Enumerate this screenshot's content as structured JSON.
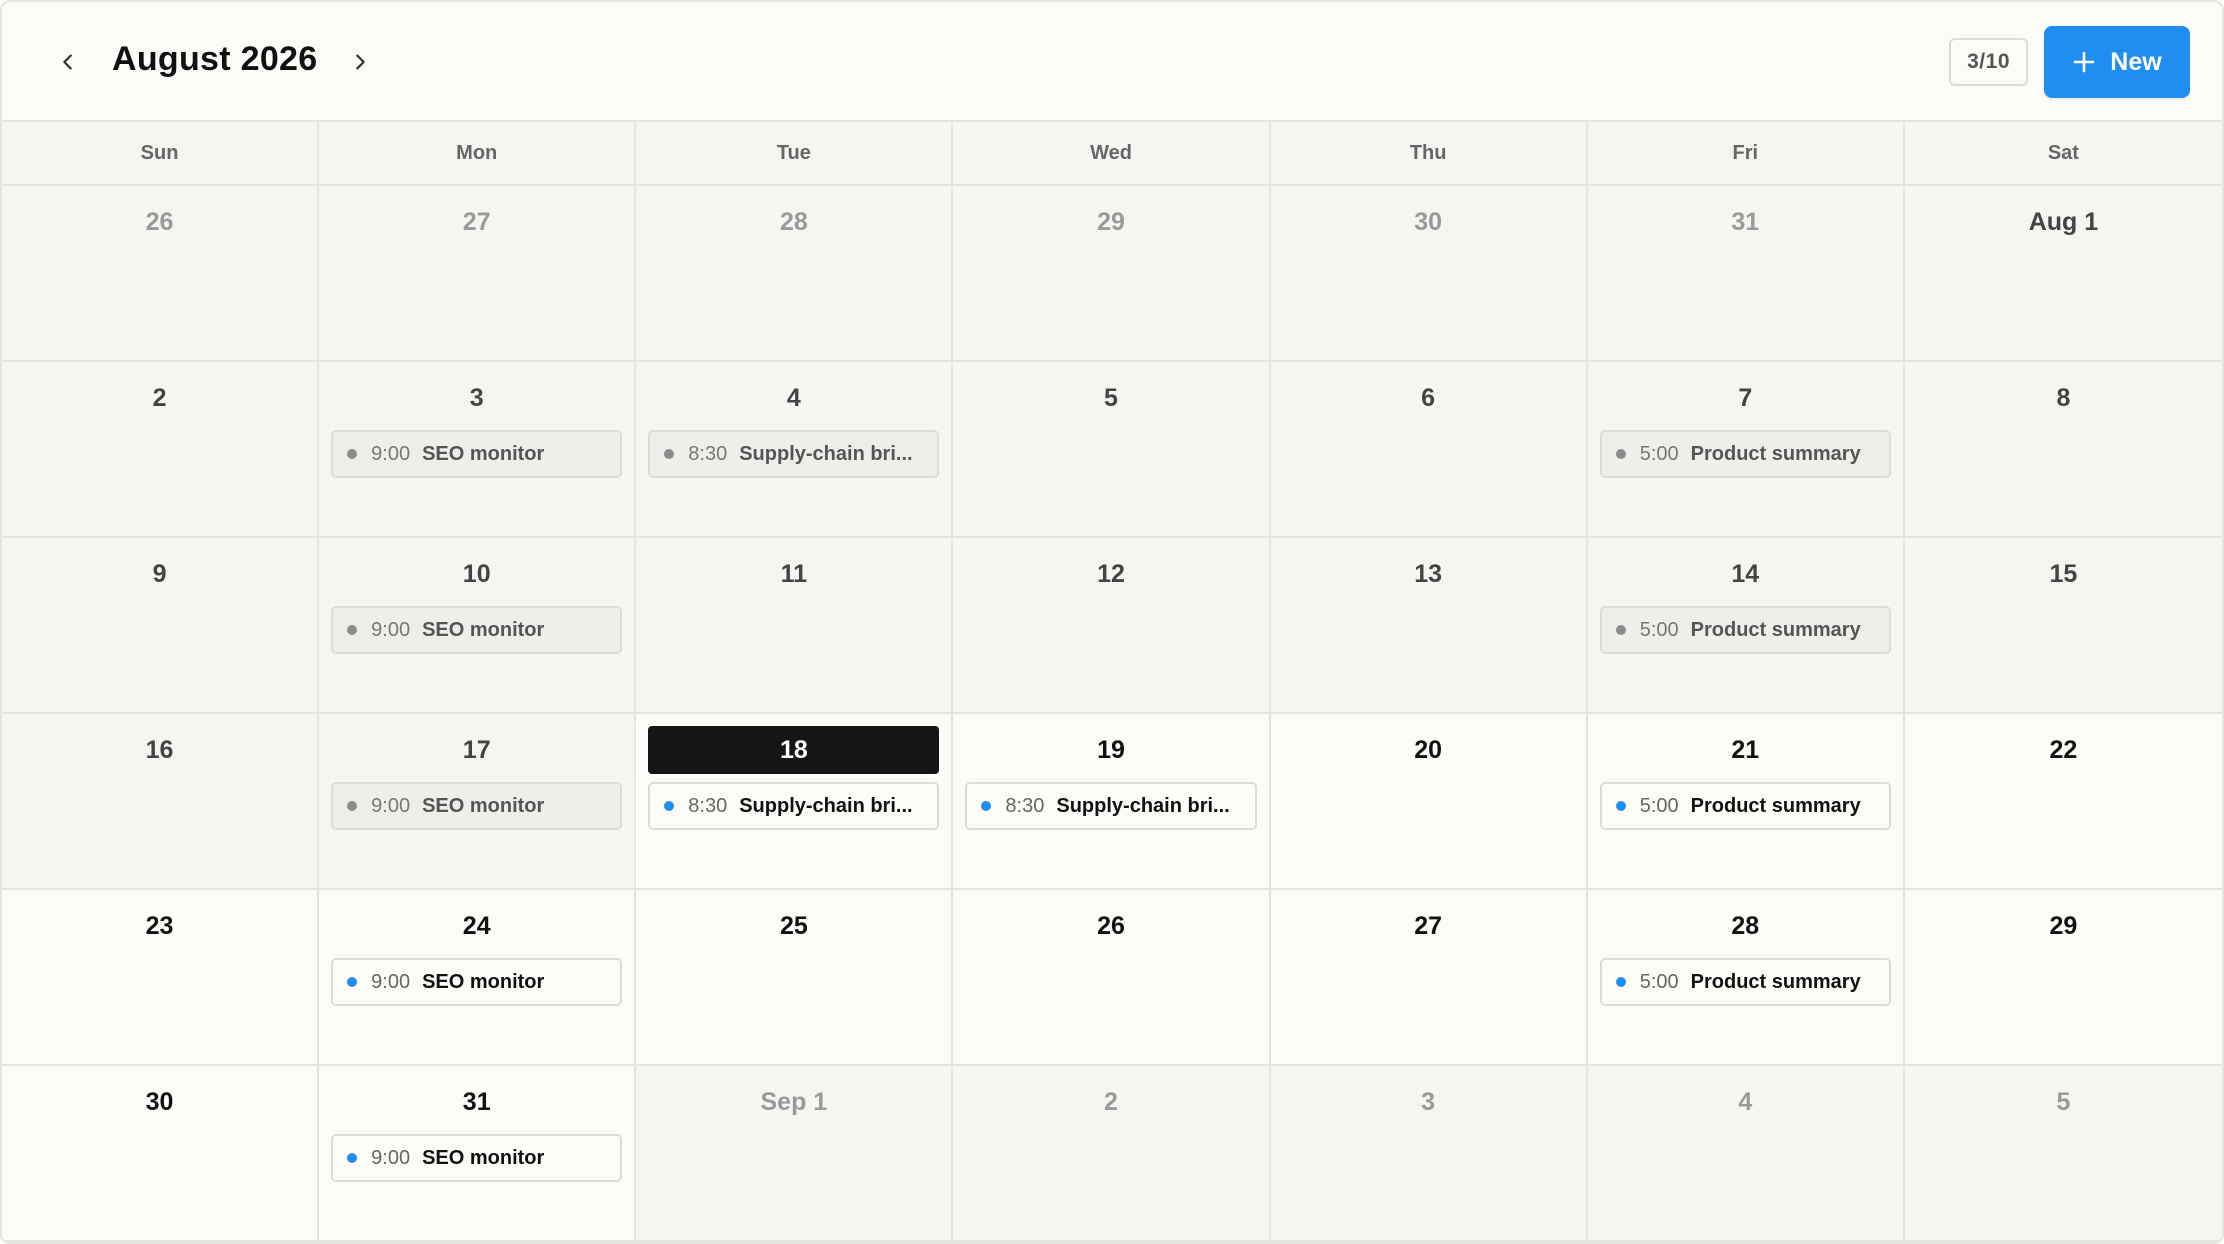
{
  "header": {
    "title": "August 2026",
    "counter": "3/10",
    "new_label": "New",
    "accent_color": "#1e8ef0"
  },
  "weekdays": [
    "Sun",
    "Mon",
    "Tue",
    "Wed",
    "Thu",
    "Fri",
    "Sat"
  ],
  "weeks": [
    [
      {
        "label": "26",
        "state": "muted",
        "events": []
      },
      {
        "label": "27",
        "state": "muted",
        "events": []
      },
      {
        "label": "28",
        "state": "muted",
        "events": []
      },
      {
        "label": "29",
        "state": "muted",
        "events": []
      },
      {
        "label": "30",
        "state": "muted",
        "events": []
      },
      {
        "label": "31",
        "state": "muted",
        "events": []
      },
      {
        "label": "Aug 1",
        "state": "past",
        "events": []
      }
    ],
    [
      {
        "label": "2",
        "state": "past",
        "events": []
      },
      {
        "label": "3",
        "state": "past",
        "events": [
          {
            "time": "9:00",
            "name": "SEO monitor",
            "past": true
          }
        ]
      },
      {
        "label": "4",
        "state": "past",
        "events": [
          {
            "time": "8:30",
            "name": "Supply-chain bri...",
            "past": true
          }
        ]
      },
      {
        "label": "5",
        "state": "past",
        "events": []
      },
      {
        "label": "6",
        "state": "past",
        "events": []
      },
      {
        "label": "7",
        "state": "past",
        "events": [
          {
            "time": "5:00",
            "name": "Product summary",
            "past": true
          }
        ]
      },
      {
        "label": "8",
        "state": "past",
        "events": []
      }
    ],
    [
      {
        "label": "9",
        "state": "past",
        "events": []
      },
      {
        "label": "10",
        "state": "past",
        "events": [
          {
            "time": "9:00",
            "name": "SEO monitor",
            "past": true
          }
        ]
      },
      {
        "label": "11",
        "state": "past",
        "events": []
      },
      {
        "label": "12",
        "state": "past",
        "events": []
      },
      {
        "label": "13",
        "state": "past",
        "events": []
      },
      {
        "label": "14",
        "state": "past",
        "events": [
          {
            "time": "5:00",
            "name": "Product summary",
            "past": true
          }
        ]
      },
      {
        "label": "15",
        "state": "past",
        "events": []
      }
    ],
    [
      {
        "label": "16",
        "state": "past",
        "events": []
      },
      {
        "label": "17",
        "state": "past",
        "events": [
          {
            "time": "9:00",
            "name": "SEO monitor",
            "past": true
          }
        ]
      },
      {
        "label": "18",
        "state": "today",
        "events": [
          {
            "time": "8:30",
            "name": "Supply-chain bri...",
            "past": false
          }
        ]
      },
      {
        "label": "19",
        "state": "current",
        "events": [
          {
            "time": "8:30",
            "name": "Supply-chain bri...",
            "past": false
          }
        ]
      },
      {
        "label": "20",
        "state": "current",
        "events": []
      },
      {
        "label": "21",
        "state": "current",
        "events": [
          {
            "time": "5:00",
            "name": "Product summary",
            "past": false
          }
        ]
      },
      {
        "label": "22",
        "state": "current",
        "events": []
      }
    ],
    [
      {
        "label": "23",
        "state": "current",
        "events": []
      },
      {
        "label": "24",
        "state": "current",
        "events": [
          {
            "time": "9:00",
            "name": "SEO monitor",
            "past": false
          }
        ]
      },
      {
        "label": "25",
        "state": "current",
        "events": []
      },
      {
        "label": "26",
        "state": "current",
        "events": []
      },
      {
        "label": "27",
        "state": "current",
        "events": []
      },
      {
        "label": "28",
        "state": "current",
        "events": [
          {
            "time": "5:00",
            "name": "Product summary",
            "past": false
          }
        ]
      },
      {
        "label": "29",
        "state": "current",
        "events": []
      }
    ],
    [
      {
        "label": "30",
        "state": "current",
        "events": []
      },
      {
        "label": "31",
        "state": "current",
        "events": [
          {
            "time": "9:00",
            "name": "SEO monitor",
            "past": false
          }
        ]
      },
      {
        "label": "Sep 1",
        "state": "muted",
        "events": []
      },
      {
        "label": "2",
        "state": "muted",
        "events": []
      },
      {
        "label": "3",
        "state": "muted",
        "events": []
      },
      {
        "label": "4",
        "state": "muted",
        "events": []
      },
      {
        "label": "5",
        "state": "muted",
        "events": []
      }
    ]
  ]
}
